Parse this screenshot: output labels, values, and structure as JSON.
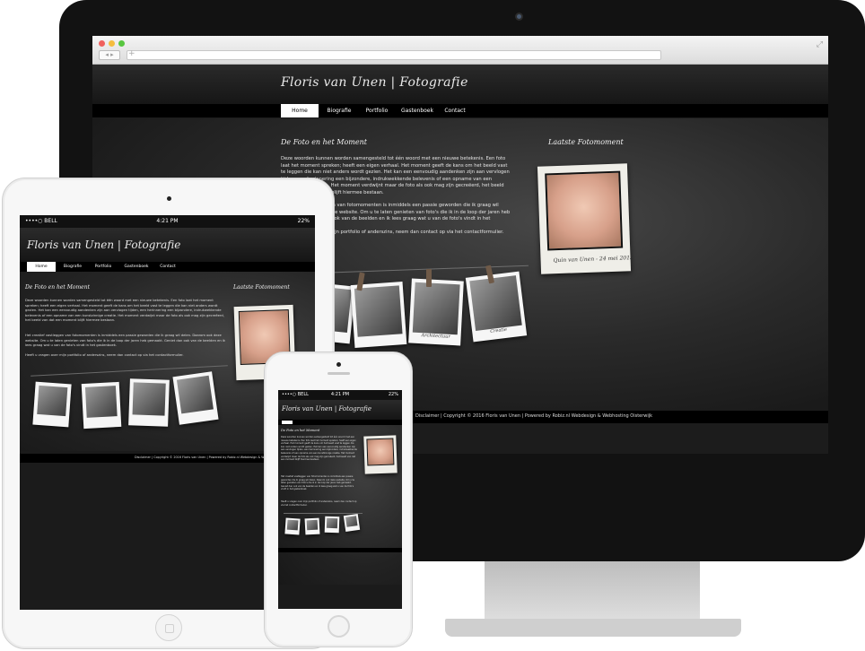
{
  "site": {
    "logo": "Floris van Unen | Fotografie",
    "nav": [
      "Home",
      "Biografie",
      "Portfolio",
      "Gastenboek",
      "Contact"
    ],
    "main_heading": "De Foto en het Moment",
    "side_heading": "Laatste Fotomoment",
    "paragraphs": [
      "Deze woorden kunnen worden samengesteld tot één woord met een nieuwe betekenis. Een foto laat het moment spreken; heeft een eigen verhaal. Het moment geeft de kans om het beeld vast te leggen die kan niet anders wordt gezien. Het kan een eenvoudig aandenken zijn aan vervlogen tijden, een herinnering een bijzondere, indrukwekkende belevenis of een opname van een kunstzinnige creatie. Het moment verdwijnt maar de foto als ook mag zijn gecreëerd, het beeld van dat een moment blijft hiermee bestaan.",
      "Het creatief vastleggen van fotomomenten is inmiddels een passie geworden die ik graag wil delen. Daarom ook deze website. Om u te laten genieten van foto's die ik in de loop der jaren heb gemaakt. Geniet dan ook van de beelden en ik lees graag wat u van de foto's vindt in het gastenboek.",
      "Heeft u vragen over mijn portfolio of anderszins, neem dan contact op via het contactformulier."
    ],
    "latest_caption": "Quin van Unen - 24 mei 2013",
    "polaroids": [
      "Natuur",
      "Portret",
      "Architectuur",
      "Creatie"
    ],
    "footer": "Disclaimer | Copyright © 2016 Floris van Unen | Powered by Robiz.nl Webdesign & Webhosting Oisterwijk"
  },
  "status_bar": {
    "carrier": "••••○ BELL",
    "time": "4:21 PM",
    "battery": "22%"
  },
  "colors": {
    "background": "#1c1c1c",
    "nav_bg": "#000000",
    "nav_active_bg": "#ffffff",
    "text": "#e6e6e6"
  }
}
